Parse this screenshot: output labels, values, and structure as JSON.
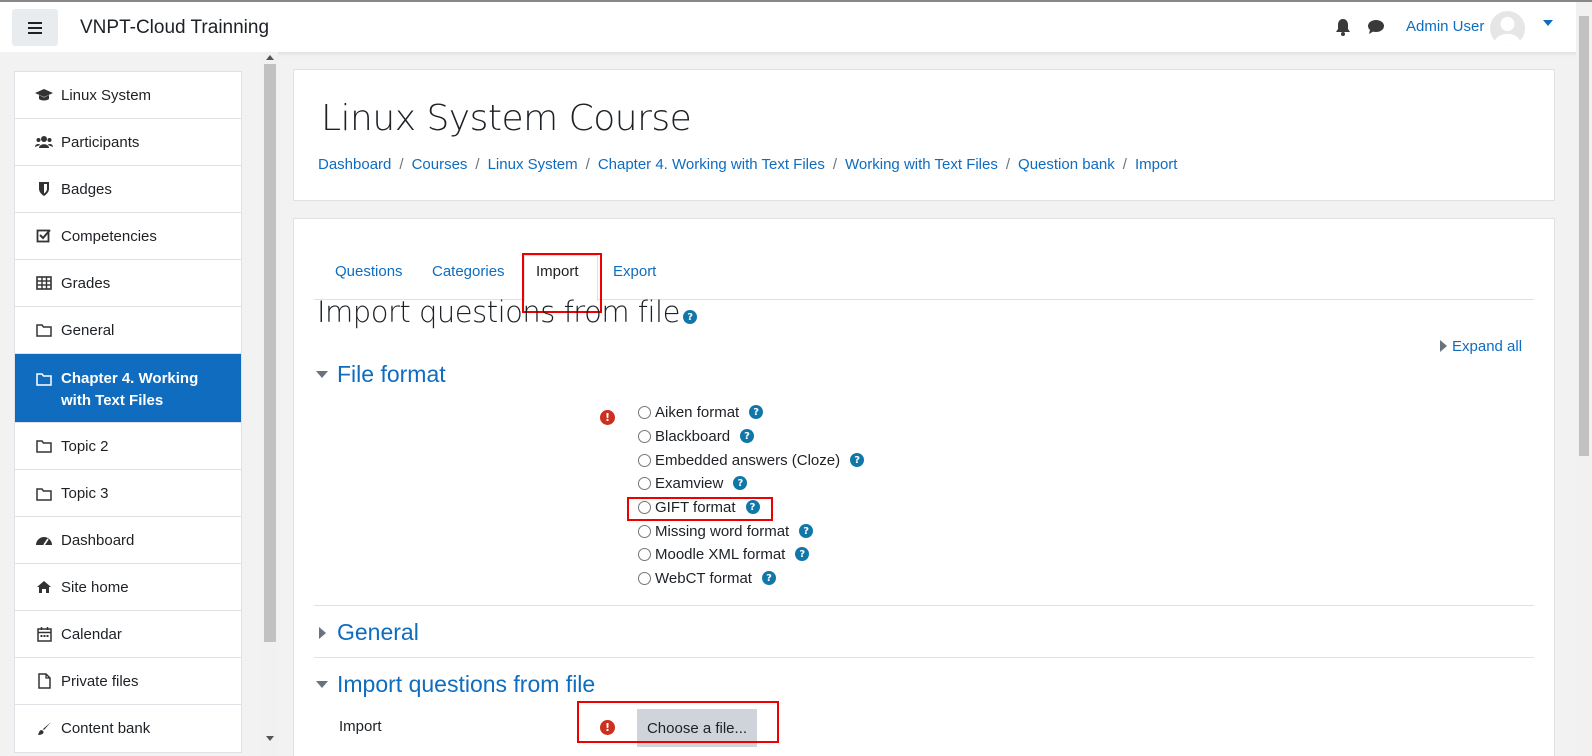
{
  "app": {
    "site_name": "VNPT-Cloud Trainning",
    "user_name": "Admin User"
  },
  "drawer": {
    "course_items": [
      {
        "label": "Linux System",
        "icon": "graduation-cap-icon"
      },
      {
        "label": "Participants",
        "icon": "users-icon"
      },
      {
        "label": "Badges",
        "icon": "shield-icon"
      },
      {
        "label": "Competencies",
        "icon": "check-square-icon"
      },
      {
        "label": "Grades",
        "icon": "table-icon"
      },
      {
        "label": "General",
        "icon": "folder-icon"
      },
      {
        "label": "Chapter 4. Working with Text Files",
        "icon": "folder-icon",
        "active": true
      },
      {
        "label": "Topic 2",
        "icon": "folder-icon"
      },
      {
        "label": "Topic 3",
        "icon": "folder-icon"
      }
    ],
    "site_items": [
      {
        "label": "Dashboard",
        "icon": "dashboard-icon"
      },
      {
        "label": "Site home",
        "icon": "home-icon"
      },
      {
        "label": "Calendar",
        "icon": "calendar-icon"
      },
      {
        "label": "Private files",
        "icon": "file-icon"
      },
      {
        "label": "Content bank",
        "icon": "brush-icon"
      }
    ]
  },
  "header": {
    "course_title": "Linux System Course",
    "breadcrumb": [
      "Dashboard",
      "Courses",
      "Linux System",
      "Chapter 4. Working with Text Files",
      "Working with Text Files",
      "Question bank",
      "Import"
    ]
  },
  "tabs": [
    "Questions",
    "Categories",
    "Import",
    "Export"
  ],
  "active_tab": "Import",
  "page": {
    "heading": "Import questions from file",
    "expand_all": "Expand all"
  },
  "sections": {
    "file_format": "File format",
    "general": "General",
    "import_from_file": "Import questions from file"
  },
  "formats": [
    "Aiken format",
    "Blackboard",
    "Embedded answers (Cloze)",
    "Examview",
    "GIFT format",
    "Missing word format",
    "Moodle XML format",
    "WebCT format"
  ],
  "import_field": {
    "label": "Import",
    "button": "Choose a file..."
  },
  "colors": {
    "link": "#0f6cbf",
    "active_nav": "#0f6cbf",
    "error": "#ca3120",
    "highlight_box": "#ee0000"
  }
}
